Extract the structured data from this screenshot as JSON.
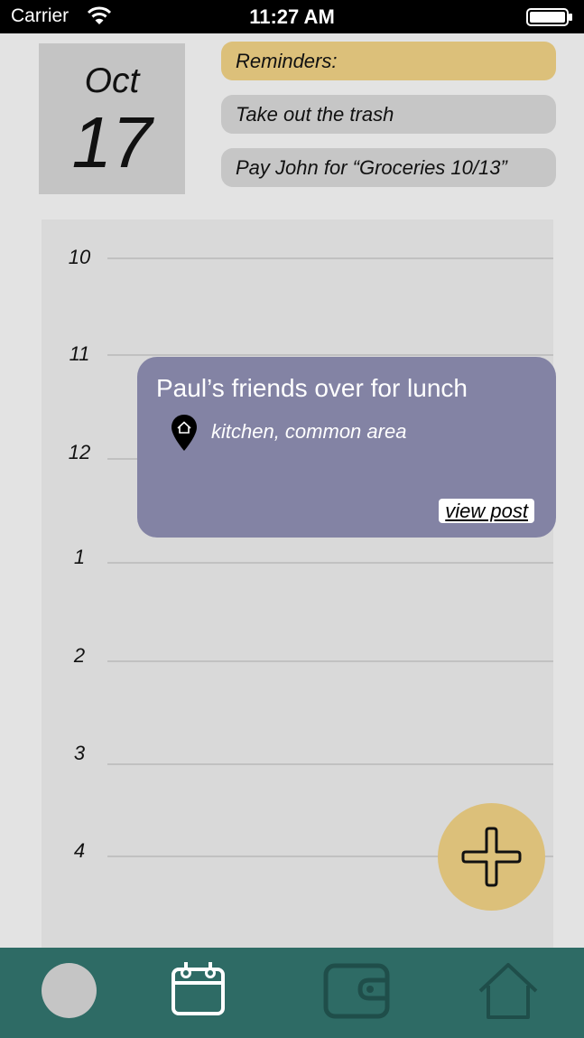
{
  "status_bar": {
    "carrier": "Carrier",
    "time": "11:27 AM"
  },
  "date": {
    "month": "Oct",
    "day": "17"
  },
  "reminders": {
    "header": "Reminders:",
    "items": [
      "Take out the trash",
      "Pay John for “Groceries 10/13”"
    ]
  },
  "schedule": {
    "hours": [
      "10",
      "11",
      "12",
      "1",
      "2",
      "3",
      "4"
    ]
  },
  "event": {
    "title": "Paul’s friends over for lunch",
    "location": "kitchen, common area",
    "location_icon": "home-location-pin-icon",
    "link_label": "view post"
  },
  "fab": {
    "icon": "plus-icon"
  },
  "bottom_nav": {
    "items": [
      "avatar",
      "calendar-icon",
      "wallet-icon",
      "home-icon"
    ],
    "active": "calendar-icon"
  },
  "colors": {
    "accent": "#dcc07a",
    "event": "#8383a4",
    "nav_bg": "#2e6b65",
    "nav_active": "#ffffff",
    "nav_inactive": "#1f4e4a"
  }
}
